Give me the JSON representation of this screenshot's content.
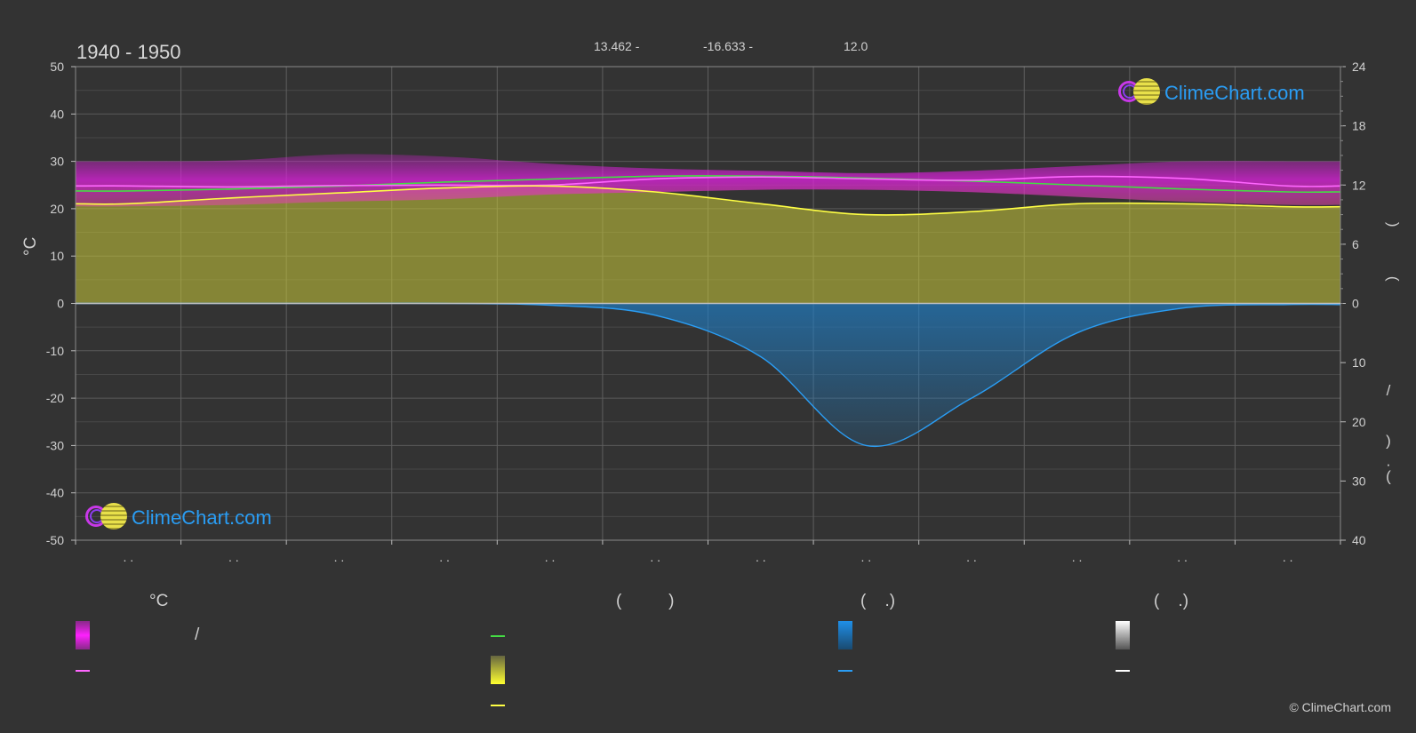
{
  "header": {
    "period": "1940 - 1950",
    "stats": [
      "13.462 -",
      "-16.633 -",
      "12.0"
    ]
  },
  "branding": {
    "logo_text": "ClimeChart.com",
    "copyright": "© ClimeChart.com"
  },
  "colors": {
    "background": "#333333",
    "max_temp_band": "#e020e0",
    "daylight_line": "#44dd44",
    "sunshine_band": "#c8c838",
    "sunshine_line": "#ffff44",
    "mean_temp_line": "#ff66ff",
    "precip_band": "#1f7fc8",
    "precip_line": "#2a9df4",
    "snow_band": "#ffffff"
  },
  "chart_data": {
    "type": "area",
    "x_tick_labels": [
      ". .",
      ". .",
      ". .",
      ". .",
      ". .",
      ". .",
      ". .",
      ". .",
      ". .",
      ". .",
      ". .",
      ". ."
    ],
    "y_left": {
      "label": "°C",
      "ylim": [
        -50,
        50
      ],
      "ticks": [
        50,
        40,
        30,
        20,
        10,
        0,
        -10,
        -20,
        -30,
        -40,
        -50
      ]
    },
    "y_right_top": {
      "ylim": [
        0,
        24
      ],
      "ticks": [
        24,
        18,
        12,
        6,
        0
      ],
      "label_glyphs": [
        ")",
        "("
      ]
    },
    "y_right_bottom": {
      "ylim": [
        0,
        40
      ],
      "ticks": [
        10,
        20,
        30,
        40
      ],
      "label_glyphs": [
        "/",
        ")",
        "·",
        "("
      ]
    },
    "grid": true,
    "series": [
      {
        "key": "daylight",
        "unit": "hours",
        "values": [
          11.4,
          11.6,
          11.9,
          12.3,
          12.6,
          12.9,
          12.9,
          12.7,
          12.4,
          12.0,
          11.6,
          11.3
        ]
      },
      {
        "key": "sunshine",
        "unit": "hours",
        "values": [
          10.1,
          10.7,
          11.2,
          11.7,
          11.9,
          11.3,
          10.1,
          9.0,
          9.3,
          10.1,
          10.1,
          9.8
        ]
      },
      {
        "key": "mean_temp",
        "unit": "°C",
        "values": [
          24.8,
          24.6,
          24.9,
          25.0,
          25.0,
          26.3,
          26.7,
          26.3,
          26.0,
          26.8,
          26.4,
          24.8
        ]
      },
      {
        "key": "max_temp_band",
        "unit": "°C",
        "low": [
          20.5,
          20.8,
          21.5,
          22.0,
          23.0,
          23.5,
          24.0,
          24.0,
          23.5,
          22.5,
          21.5,
          20.8
        ],
        "high": [
          30.0,
          30.2,
          31.5,
          31.0,
          29.5,
          28.5,
          28.0,
          27.5,
          28.0,
          29.0,
          30.0,
          30.0
        ]
      },
      {
        "key": "precipitation",
        "unit": "mm",
        "values": [
          0.0,
          0.0,
          0.0,
          0.0,
          0.3,
          2.0,
          9.0,
          24.0,
          16.0,
          5.0,
          0.8,
          0.2
        ]
      }
    ]
  },
  "legend": {
    "headers": [
      "°C",
      "(          )",
      "(    .)",
      "(    .)"
    ],
    "separator": "/"
  }
}
